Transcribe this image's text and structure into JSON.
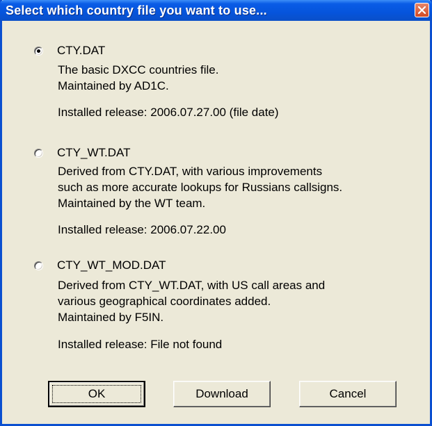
{
  "window": {
    "title": "Select which country file you want to use..."
  },
  "options": [
    {
      "label": "CTY.DAT",
      "selected": true,
      "description_lines": [
        "The basic DXCC countries file.",
        "Maintained by AD1C."
      ],
      "installed": "Installed release: 2006.07.27.00 (file date)"
    },
    {
      "label": "CTY_WT.DAT",
      "selected": false,
      "description_lines": [
        "Derived from CTY.DAT, with various improvements",
        "such as more accurate lookups for Russians callsigns.",
        "Maintained by the WT team."
      ],
      "installed": "Installed release: 2006.07.22.00"
    },
    {
      "label": "CTY_WT_MOD.DAT",
      "selected": false,
      "description_lines": [
        "Derived from CTY_WT.DAT, with US call areas and",
        "various geographical coordinates added.",
        "Maintained by F5IN."
      ],
      "installed": "Installed release: File not found"
    }
  ],
  "buttons": {
    "ok": "OK",
    "download": "Download",
    "cancel": "Cancel"
  },
  "colors": {
    "titlebar": "#0554dc",
    "dialog_face": "#ece9d8",
    "close_button": "#d24a24"
  },
  "icons": {
    "close": "close-icon"
  }
}
